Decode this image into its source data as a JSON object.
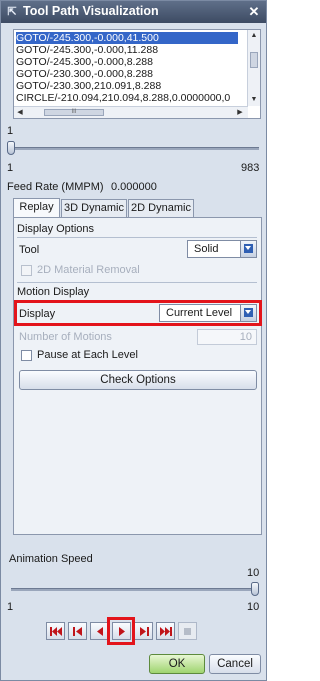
{
  "window": {
    "title": "Tool Path Visualization",
    "close_glyph": "✕"
  },
  "code_list": {
    "lines": [
      "GOTO/-245.300,-0.000,41.500",
      "GOTO/-245.300,-0.000,11.288",
      "GOTO/-245.300,-0.000,8.288",
      "GOTO/-230.300,-0.000,8.288",
      "GOTO/-230.300,210.091,8.288",
      "CIRCLE/-210.094,210.094,8.288,0.0000000,0"
    ],
    "selected_index": 0,
    "hscroll_thumb_glyph": "III"
  },
  "slider": {
    "value_label": "1",
    "min_label": "1",
    "max_label": "983"
  },
  "feed_rate": {
    "label": "Feed Rate (MMPM)",
    "value": "0.000000"
  },
  "tabs": [
    {
      "label": "Replay",
      "active": true
    },
    {
      "label": "3D Dynamic",
      "active": false
    },
    {
      "label": "2D Dynamic",
      "active": false
    }
  ],
  "display_options": {
    "header": "Display Options",
    "tool_label": "Tool",
    "tool_value": "Solid",
    "material_removal_label": "2D Material Removal"
  },
  "motion_display": {
    "header": "Motion Display",
    "display_label": "Display",
    "display_value": "Current Level",
    "number_of_motions_label": "Number of Motions",
    "number_of_motions_value": "10",
    "pause_label": "Pause at Each Level",
    "check_options_label": "Check Options"
  },
  "animation_speed": {
    "label": "Animation Speed",
    "value_label": "10",
    "min_label": "1",
    "max_label": "10"
  },
  "playback": {
    "buttons": [
      "skip-to-start",
      "step-back",
      "play-reverse",
      "play-forward",
      "step-forward",
      "skip-to-end",
      "stop"
    ]
  },
  "footer": {
    "ok_label": "OK",
    "cancel_label": "Cancel"
  },
  "colors": {
    "highlight_red": "#e3141b",
    "selection_blue": "#3466c8",
    "transport_red": "#c0141a"
  }
}
